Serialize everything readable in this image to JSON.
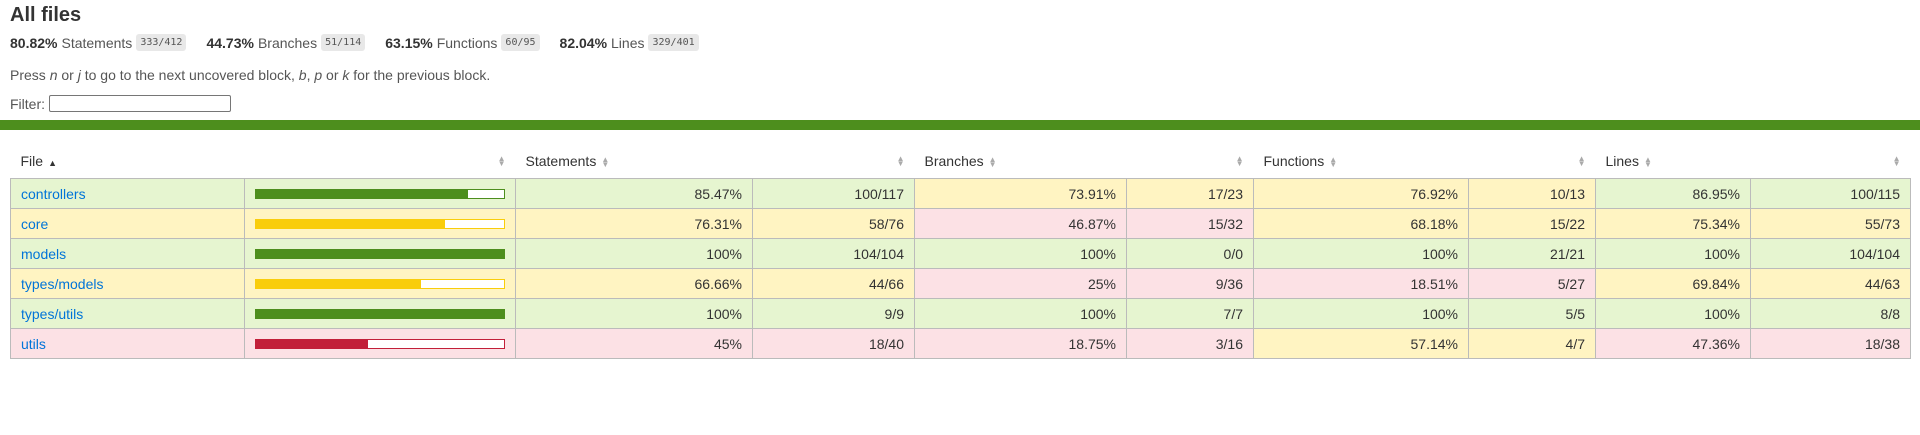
{
  "header": {
    "title": "All files",
    "metrics": [
      {
        "pct": "80.82%",
        "label": "Statements",
        "fraction": "333/412"
      },
      {
        "pct": "44.73%",
        "label": "Branches",
        "fraction": "51/114"
      },
      {
        "pct": "63.15%",
        "label": "Functions",
        "fraction": "60/95"
      },
      {
        "pct": "82.04%",
        "label": "Lines",
        "fraction": "329/401"
      }
    ],
    "hint_parts": [
      "Press ",
      "n",
      " or ",
      "j",
      " to go to the next uncovered block, ",
      "b",
      ", ",
      "p",
      " or ",
      "k",
      " for the previous block."
    ],
    "filter_label": "Filter:",
    "filter_value": ""
  },
  "colors": {
    "high_bg": "#e6f5d0",
    "medium_bg": "#fff4c2",
    "low_bg": "#fce1e5",
    "high_bar": "#4d8e1d",
    "medium_bar": "#f9cd0b",
    "low_bar": "#c21f39",
    "link": "#0074d9"
  },
  "table": {
    "columns": [
      "File",
      "Statements",
      "Branches",
      "Functions",
      "Lines"
    ],
    "rows": [
      {
        "file": "controllers",
        "bar_level": "high",
        "bar_pct": 85.47,
        "stmt_pct": "85.47%",
        "stmt_frac": "100/117",
        "stmt_level": "high",
        "branch_pct": "73.91%",
        "branch_frac": "17/23",
        "branch_level": "medium",
        "func_pct": "76.92%",
        "func_frac": "10/13",
        "func_level": "medium",
        "line_pct": "86.95%",
        "line_frac": "100/115",
        "line_level": "high"
      },
      {
        "file": "core",
        "bar_level": "medium",
        "bar_pct": 76.31,
        "stmt_pct": "76.31%",
        "stmt_frac": "58/76",
        "stmt_level": "medium",
        "branch_pct": "46.87%",
        "branch_frac": "15/32",
        "branch_level": "low",
        "func_pct": "68.18%",
        "func_frac": "15/22",
        "func_level": "medium",
        "line_pct": "75.34%",
        "line_frac": "55/73",
        "line_level": "medium"
      },
      {
        "file": "models",
        "bar_level": "high",
        "bar_pct": 100,
        "stmt_pct": "100%",
        "stmt_frac": "104/104",
        "stmt_level": "high",
        "branch_pct": "100%",
        "branch_frac": "0/0",
        "branch_level": "high",
        "func_pct": "100%",
        "func_frac": "21/21",
        "func_level": "high",
        "line_pct": "100%",
        "line_frac": "104/104",
        "line_level": "high"
      },
      {
        "file": "types/models",
        "bar_level": "medium",
        "bar_pct": 66.66,
        "stmt_pct": "66.66%",
        "stmt_frac": "44/66",
        "stmt_level": "medium",
        "branch_pct": "25%",
        "branch_frac": "9/36",
        "branch_level": "low",
        "func_pct": "18.51%",
        "func_frac": "5/27",
        "func_level": "low",
        "line_pct": "69.84%",
        "line_frac": "44/63",
        "line_level": "medium"
      },
      {
        "file": "types/utils",
        "bar_level": "high",
        "bar_pct": 100,
        "stmt_pct": "100%",
        "stmt_frac": "9/9",
        "stmt_level": "high",
        "branch_pct": "100%",
        "branch_frac": "7/7",
        "branch_level": "high",
        "func_pct": "100%",
        "func_frac": "5/5",
        "func_level": "high",
        "line_pct": "100%",
        "line_frac": "8/8",
        "line_level": "high"
      },
      {
        "file": "utils",
        "bar_level": "low",
        "bar_pct": 45,
        "stmt_pct": "45%",
        "stmt_frac": "18/40",
        "stmt_level": "low",
        "branch_pct": "18.75%",
        "branch_frac": "3/16",
        "branch_level": "low",
        "func_pct": "57.14%",
        "func_frac": "4/7",
        "func_level": "medium",
        "line_pct": "47.36%",
        "line_frac": "18/38",
        "line_level": "low"
      }
    ]
  }
}
